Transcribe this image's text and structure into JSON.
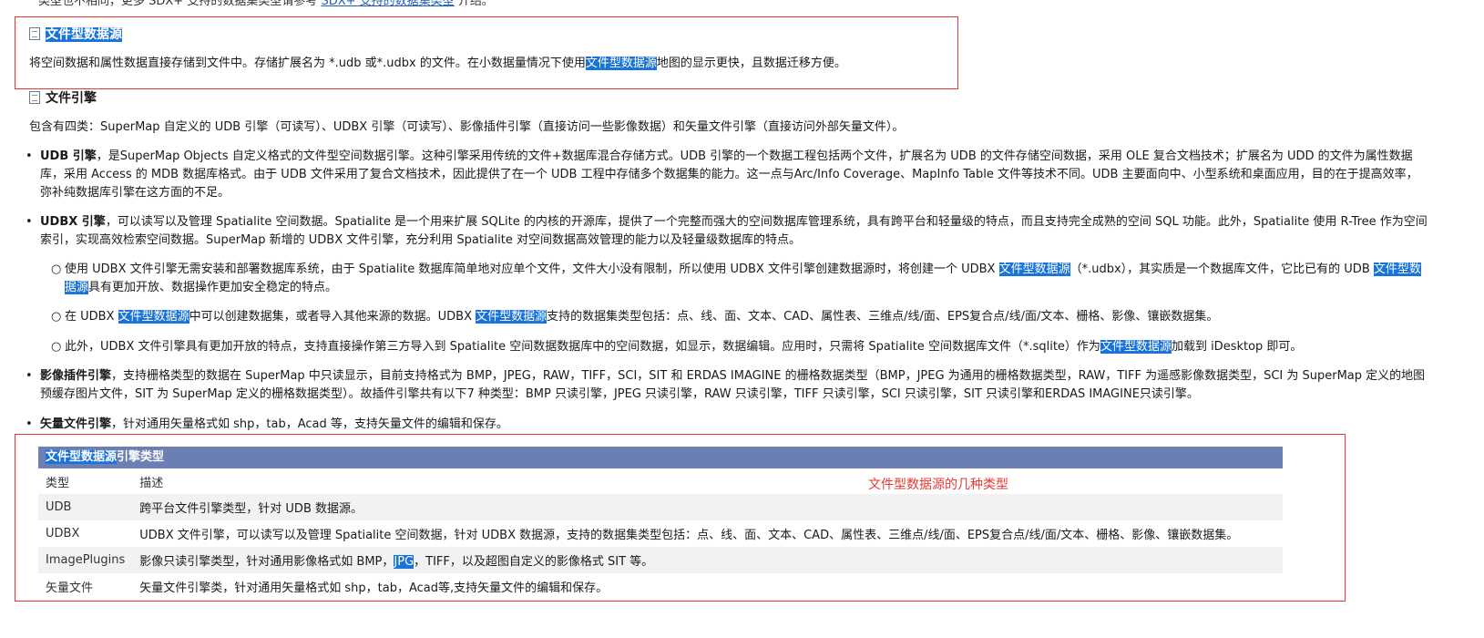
{
  "top_line": {
    "text_before": "类型也不相同，更多 SDX+ 支持的数据集类型请参考 ",
    "link": "SDX+ 支持的数据集类型",
    "text_after": " 介绍。"
  },
  "file_datasource": {
    "heading": "文件型数据源",
    "desc_1": "将空间数据和属性数据直接存储到文件中。存储扩展名为 *.udb 或*.udbx 的文件。在小数据量情况下使用",
    "desc_hl": "文件型数据源",
    "desc_2": "地图的显示更快，且数据迁移方便。"
  },
  "file_engine": {
    "heading": "文件引擎",
    "intro": "包含有四类：SuperMap 自定义的 UDB 引擎（可读写）、UDBX 引擎（可读写）、影像插件引擎（直接访问一些影像数据）和矢量文件引擎（直接访问外部矢量文件）。",
    "udb_title": "UDB 引擎",
    "udb_text": "，是SuperMap Objects 自定义格式的文件型空间数据引擎。这种引擎采用传统的文件+数据库混合存储方式。UDB 引擎的一个数据工程包括两个文件，扩展名为 UDB 的文件存储空间数据，采用 OLE 复合文档技术；扩展名为 UDD 的文件为属性数据库，采用 Access 的 MDB 数据库格式。由于 UDB 文件采用了复合文档技术，因此提供了在一个 UDB 工程中存储多个数据集的能力。这一点与Arc/Info Coverage、MapInfo Table 文件等技术不同。UDB 主要面向中、小型系统和桌面应用，目的在于提高效率，弥补纯数据库引擎在这方面的不足。",
    "udbx_title": "UDBX 引擎",
    "udbx_text": "，可以读写以及管理 Spatialite 空间数据。Spatialite 是一个用来扩展 SQLite 的内核的开源库，提供了一个完整而强大的空间数据库管理系统，具有跨平台和轻量级的特点，而且支持完全成熟的空间 SQL 功能。此外，Spatialite 使用 R-Tree 作为空间索引，实现高效检索空间数据。SuperMap 新增的 UDBX 文件引擎，充分利用 Spatialite 对空间数据高效管理的能力以及轻量级数据库的特点。",
    "sub1_a": "使用 UDBX 文件引擎无需安装和部署数据库系统，由于 Spatialite 数据库简单地对应单个文件，文件大小没有限制，所以使用 UDBX 文件引擎创建数据源时，将创建一个 UDBX ",
    "sub1_hl1": "文件型数据源",
    "sub1_b": "（*.udbx），其实质是一个数据库文件，它比已有的 UDB ",
    "sub1_hl2": "文件型数据源",
    "sub1_c": "具有更加开放、数据操作更加安全稳定的特点。",
    "sub2_a": "在 UDBX ",
    "sub2_hl1": "文件型数据源",
    "sub2_b": "中可以创建数据集，或者导入其他来源的数据。UDBX ",
    "sub2_hl2": "文件型数据源",
    "sub2_c": "支持的数据集类型包括：点、线、面、文本、CAD、属性表、三维点/线/面、EPS复合点/线/面/文本、栅格、影像、镶嵌数据集。",
    "sub3_a": "此外，UDBX 文件引擎具有更加开放的特点，支持直接操作第三方导入到 Spatialite 空间数据数据库中的空间数据，如显示，数据编辑。应用时，只需将 Spatialite 空间数据库文件（*.sqlite）作为",
    "sub3_hl": "文件型数据源",
    "sub3_b": "加载到 iDesktop 即可。",
    "img_title": "影像插件引擎",
    "img_text": "，支持栅格类型的数据在 SuperMap 中只读显示，目前支持格式为 BMP，JPEG，RAW，TIFF，SCI，SIT 和 ERDAS IMAGINE 的栅格数据类型（BMP，JPEG 为通用的栅格数据类型，RAW，TIFF 为遥感影像数据类型，SCI 为 SuperMap 定义的地图预缓存图片文件，SIT 为 SuperMap 定义的栅格数据类型）。故插件引擎共有以下7 种类型：BMP 只读引擎，JPEG 只读引擎，RAW 只读引擎，TIFF 只读引擎，SCI 只读引擎，SIT 只读引擎和ERDAS IMAGINE只读引擎。",
    "vec_title": "矢量文件引擎",
    "vec_text": "，针对通用矢量格式如 shp，tab，Acad 等，支持矢量文件的编辑和保存。"
  },
  "table": {
    "caption_hl": "文件型数据源",
    "caption_rest": "引擎类型",
    "col_type": "类型",
    "col_desc": "描述",
    "rows": [
      {
        "type": "UDB",
        "desc": "跨平台文件引擎类型，针对 UDB 数据源。"
      },
      {
        "type": "UDBX",
        "desc": "UDBX 文件引擎，可以读写以及管理 Spatialite 空间数据，针对 UDBX 数据源，支持的数据集类型包括：点、线、面、文本、CAD、属性表、三维点/线/面、EPS复合点/线/面/文本、栅格、影像、镶嵌数据集。"
      },
      {
        "type": "ImagePlugins",
        "desc_a": "影像只读引擎类型，针对通用影像格式如 BMP，",
        "desc_hl": "JPG",
        "desc_b": "，TIFF，以及超图自定义的影像格式 SIT 等。"
      },
      {
        "type": "矢量文件",
        "desc": "矢量文件引擎类，针对通用矢量格式如 shp，tab，Acad等,支持矢量文件的编辑和保存。"
      }
    ]
  },
  "annotation": "文件型数据源的几种类型",
  "colors": {
    "highlight": "#1a73d9",
    "red_box": "#e53935",
    "table_header": "#6b7fb2"
  }
}
